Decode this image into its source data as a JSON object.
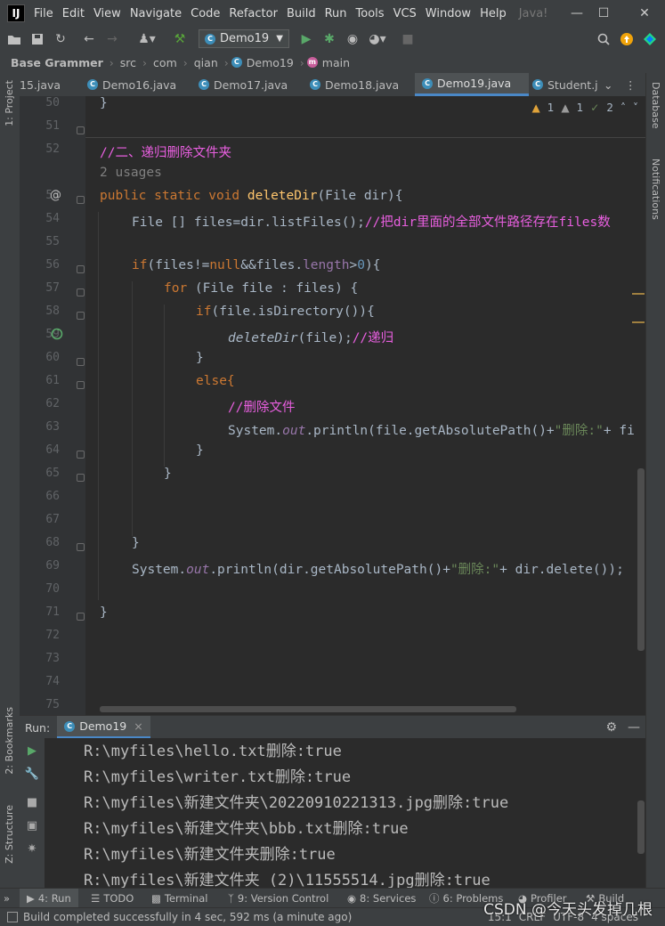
{
  "menu": {
    "items": [
      "File",
      "Edit",
      "View",
      "Navigate",
      "Code",
      "Refactor",
      "Build",
      "Run",
      "Tools",
      "VCS",
      "Window",
      "Help"
    ],
    "window_title": "Java!"
  },
  "toolbar": {
    "run_config": "Demo19"
  },
  "breadcrumb": {
    "project": "Base Grammer",
    "items": [
      "src",
      "com",
      "qian",
      "Demo19",
      "main"
    ]
  },
  "tabs": [
    {
      "label": "15.java",
      "active": false
    },
    {
      "label": "Demo16.java",
      "active": false
    },
    {
      "label": "Demo17.java",
      "active": false
    },
    {
      "label": "Demo18.java",
      "active": false
    },
    {
      "label": "Demo19.java",
      "active": true
    },
    {
      "label": "Student.j",
      "active": false
    }
  ],
  "left_tools": [
    "1: Project",
    "2: Bookmarks",
    "Z: Structure"
  ],
  "right_tools": [
    "Database",
    "Notifications"
  ],
  "inspections": {
    "warnings": "1",
    "weak_warnings": "1",
    "typos": "2"
  },
  "line_numbers": [
    "50",
    "51",
    "52",
    "",
    "53",
    "54",
    "55",
    "56",
    "57",
    "58",
    "59",
    "60",
    "61",
    "62",
    "63",
    "64",
    "65",
    "66",
    "67",
    "68",
    "69",
    "70",
    "71",
    "72",
    "73",
    "74",
    "75"
  ],
  "code": {
    "l50": "}",
    "l52": "//二、递归删除文件夹",
    "usages": "2 usages",
    "l53_kw": "public static void ",
    "l53_fn": "deleteDir",
    "l53_rest": "(File dir){",
    "l54_a": "File [] files=dir.listFiles();",
    "l54_cm": "//把dir里面的全部文件路径存在files数",
    "l56_if": "if",
    "l56_a": "(files!=",
    "l56_null": "null",
    "l56_b": "&&files.",
    "l56_len": "length",
    "l56_c": ">",
    "l56_zero": "0",
    "l56_d": "){",
    "l57_for": "for",
    "l57_rest": " (File file : files) {",
    "l58_if": "if",
    "l58_rest": "(file.isDirectory()){",
    "l59_call": "deleteDir",
    "l59_rest": "(file);",
    "l59_cm": "//递归",
    "l60": "}",
    "l61": "else{",
    "l62": "//删除文件",
    "l63_a": "System.",
    "l63_out": "out",
    "l63_b": ".println(file.getAbsolutePath()+",
    "l63_str": "\"删除:\"",
    "l63_c": "+ fi",
    "l64": "}",
    "l65": "}",
    "l68": "}",
    "l69_a": "System.",
    "l69_out": "out",
    "l69_b": ".println(dir.getAbsolutePath()+",
    "l69_str": "\"删除:\"",
    "l69_c": "+ dir.delete());",
    "l71": "}"
  },
  "run": {
    "label": "Run:",
    "tab": "Demo19",
    "output": [
      "R:\\myfiles\\hello.txt删除:true",
      "R:\\myfiles\\writer.txt删除:true",
      "R:\\myfiles\\新建文件夹\\20220910221313.jpg删除:true",
      "R:\\myfiles\\新建文件夹\\bbb.txt删除:true",
      "R:\\myfiles\\新建文件夹删除:true",
      "R:\\myfiles\\新建文件夹 (2)\\11555514.jpg删除:true"
    ]
  },
  "bottom_tabs": [
    "4: Run",
    "TODO",
    "Terminal",
    "9: Version Control",
    "8: Services",
    "6: Problems",
    "Profiler",
    "Build"
  ],
  "status": {
    "message": "Build completed successfully in 4 sec, 592 ms (a minute ago)",
    "position": "15:1",
    "line_sep": "CRLF",
    "encoding": "UTF-8",
    "indent": "4 spaces"
  },
  "watermark": "CSDN @今天头发掉几根"
}
